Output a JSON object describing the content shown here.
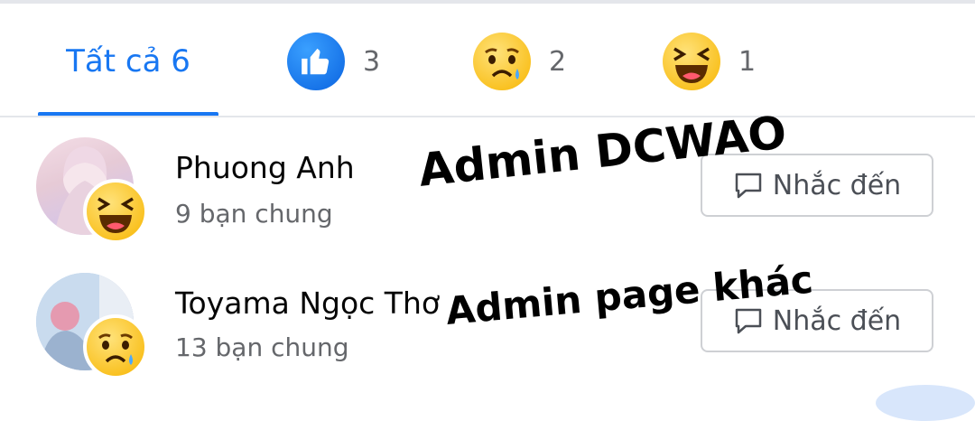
{
  "tabs": {
    "all_label": "Tất cả 6",
    "like": {
      "icon": "thumbs-up-icon",
      "count": "3"
    },
    "sad": {
      "icon": "sad-face-icon",
      "count": "2"
    },
    "haha": {
      "icon": "laughing-face-icon",
      "count": "1"
    }
  },
  "people": [
    {
      "name": "Phuong Anh",
      "mutual": "9 bạn chung",
      "reaction": "laughing-face-icon",
      "button": "Nhắc đến"
    },
    {
      "name": "Toyama Ngọc Thơ",
      "mutual": "13 bạn chung",
      "reaction": "sad-face-icon",
      "button": "Nhắc đến"
    }
  ],
  "overlay_text": [
    "Admin DCWAO",
    "Admin page khác"
  ],
  "colors": {
    "accent": "#1877f2",
    "divider": "#e4e6eb",
    "muted": "#65676b"
  }
}
